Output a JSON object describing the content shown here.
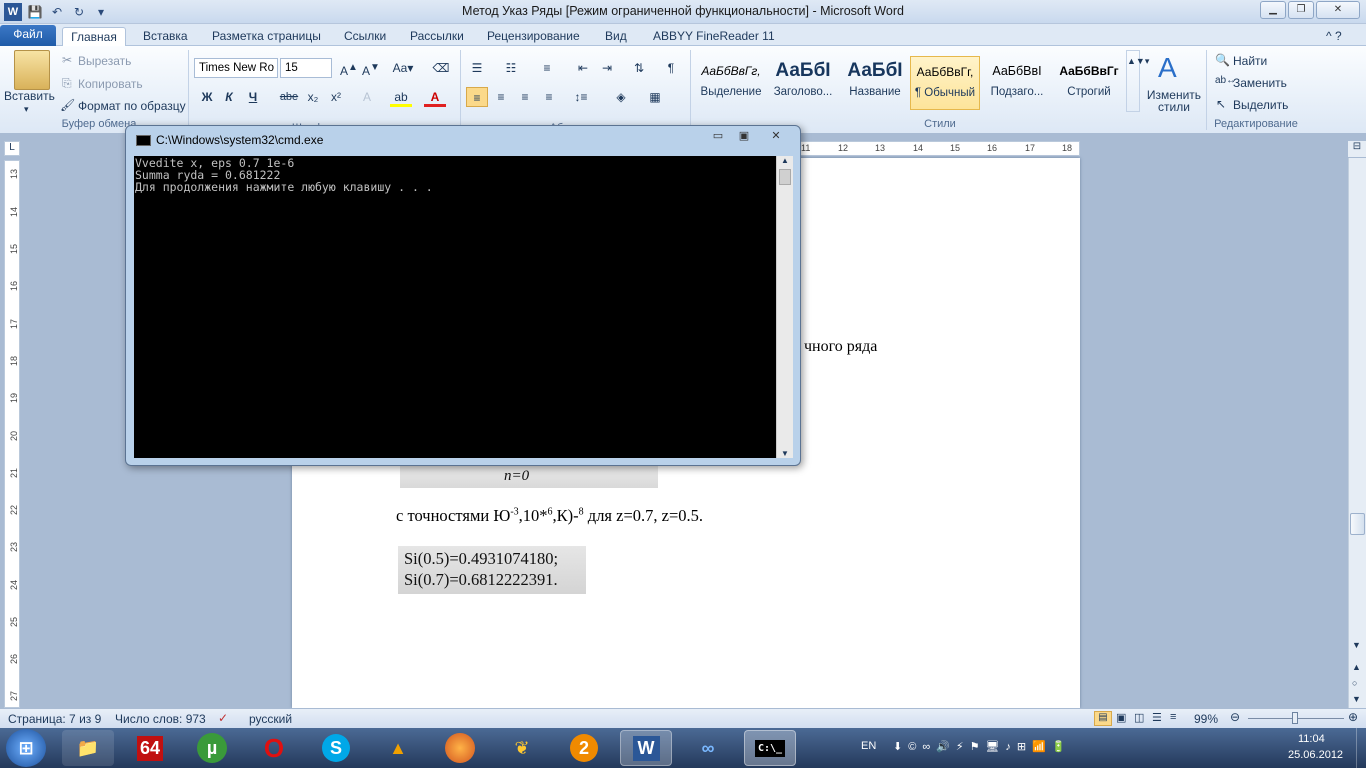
{
  "window": {
    "title": "Метод Указ Ряды [Режим ограниченной функциональности]  -  Microsoft Word"
  },
  "tabs": [
    {
      "label": "Файл"
    },
    {
      "label": "Главная"
    },
    {
      "label": "Вставка"
    },
    {
      "label": "Разметка страницы"
    },
    {
      "label": "Ссылки"
    },
    {
      "label": "Рассылки"
    },
    {
      "label": "Рецензирование"
    },
    {
      "label": "Вид"
    },
    {
      "label": "ABBYY FineReader 11"
    }
  ],
  "clipboard": {
    "paste": "Вставить",
    "cut": "Вырезать",
    "copy": "Копировать",
    "format_painter": "Формат по образцу",
    "group": "Буфер обмена"
  },
  "font": {
    "name": "Times New Ro",
    "size": "15",
    "group": "Шрифт",
    "bold": "Ж",
    "italic": "К",
    "underline": "Ч",
    "strike": "abe",
    "sub": "x₂",
    "sup": "x²"
  },
  "paragraph": {
    "group": "Абзац"
  },
  "styles": {
    "group": "Стили",
    "items": [
      {
        "sample": "АаБбВвГг,",
        "label": "Выделение"
      },
      {
        "sample": "АаБбІ",
        "label": "Заголово..."
      },
      {
        "sample": "АаБбІ",
        "label": "Название"
      },
      {
        "sample": "АаБбВвГг,",
        "label": "¶ Обычный"
      },
      {
        "sample": "АаБбВвІ",
        "label": "Подзаго..."
      },
      {
        "sample": "АаБбВвГг",
        "label": "Строгий"
      }
    ],
    "change": "Изменить стили"
  },
  "editing": {
    "group": "Редактирование",
    "find": "Найти",
    "replace": "Заменить",
    "select": "Выделить"
  },
  "ruler": {
    "h_ticks": [
      "11",
      "12",
      "13",
      "14",
      "15",
      "16",
      "17",
      "18"
    ],
    "v_ticks": [
      "13",
      "14",
      "15",
      "16",
      "17",
      "18",
      "19",
      "20",
      "21",
      "22",
      "23",
      "24",
      "25",
      "26",
      "27"
    ]
  },
  "document": {
    "frag1": "чного ряда",
    "formula_bottom": "n=0",
    "line1": "с точностями Ю",
    "line1_sup1": "-3",
    "line1_mid": ",10*",
    "line1_sup2": "6",
    "line1_mid2": ",К)-",
    "line1_sup3": "8",
    "line1_end": " для z=0.7, z=0.5.",
    "result1": "Si(0.5)=0.4931074180;",
    "result2": "Si(0.7)=0.6812222391."
  },
  "cmd": {
    "title": "C:\\Windows\\system32\\cmd.exe",
    "lines": [
      "Vvedite x, eps 0.7 1e-6",
      "Summa ryda = 0.681222",
      "Для продолжения нажмите любую клавишу . . ."
    ]
  },
  "status": {
    "page": "Страница: 7 из 9",
    "words": "Число слов: 973",
    "lang": "русский",
    "zoom": "99%"
  },
  "taskbar": {
    "lang": "EN",
    "time": "11:04",
    "date": "25.06.2012",
    "apps": [
      "64",
      "µ",
      "O",
      "S",
      "▲",
      "",
      "",
      "2",
      "W",
      "",
      "C:\\_"
    ]
  }
}
